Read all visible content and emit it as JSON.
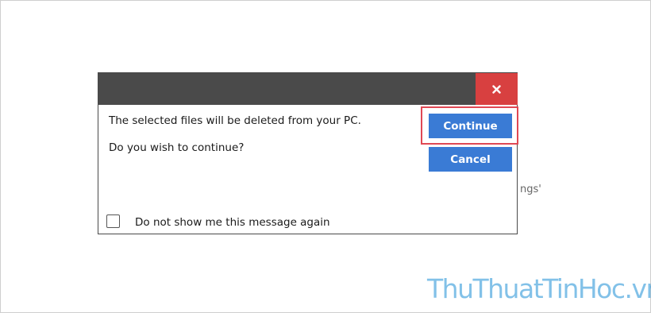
{
  "background": {
    "fragment_text": "ngs'"
  },
  "dialog": {
    "close_glyph": "×",
    "message_line1": "The selected files will be deleted from your PC.",
    "message_line2": "Do you wish to continue?",
    "continue_label": "Continue",
    "cancel_label": "Cancel",
    "checkbox_label": "Do not show me this message again",
    "checkbox_checked": false
  },
  "watermark": {
    "text": "ThuThuatTinHoc.vn"
  },
  "colors": {
    "titlebar": "#4a4a4a",
    "close": "#d84040",
    "button": "#3a7bd5",
    "highlight": "#e04854",
    "watermark": "#1d8fd6"
  }
}
